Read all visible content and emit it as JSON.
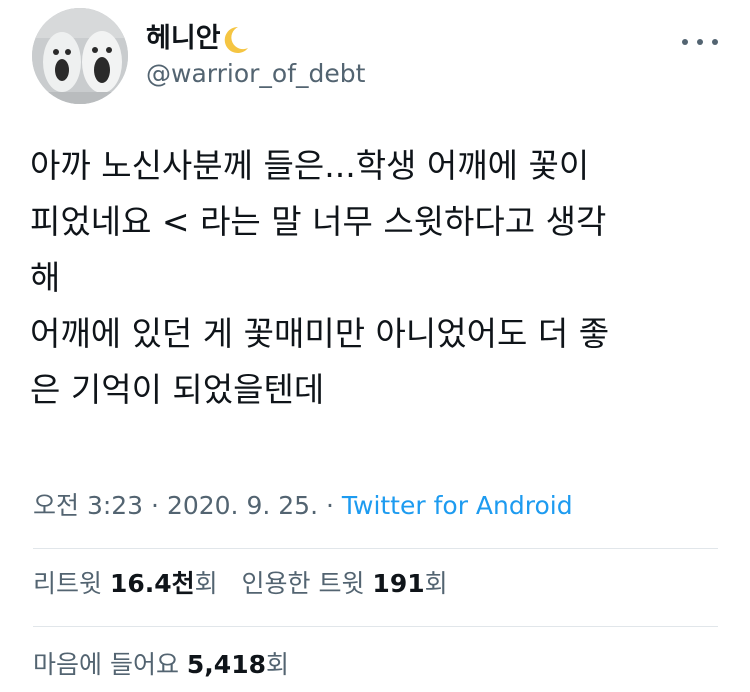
{
  "author": {
    "display_name": "헤니안",
    "handle": "@warrior_of_debt"
  },
  "tweet": {
    "lines": [
      "아까 노신사분께 들은...학생 어깨에 꽃이",
      "피었네요 < 라는 말 너무 스윗하다고 생각",
      "해",
      "어깨에 있던 게 꽃매미만 아니었어도 더 좋",
      "은 기억이 되었을텐데"
    ]
  },
  "meta": {
    "time": "오전 3:23",
    "separator": " · ",
    "date": "2020. 9. 25.",
    "separator2": " · ",
    "source": "Twitter for Android"
  },
  "stats": {
    "retweets_label": "리트윗",
    "retweets_value": "16.4천",
    "retweets_unit": "회",
    "quotes_label": "인용한 트윗",
    "quotes_value": "191",
    "quotes_unit": "회",
    "likes_label": "마음에 들어요",
    "likes_value": "5,418",
    "likes_unit": "회"
  },
  "icons": {
    "avatar": "snowman-faces-avatar",
    "emoji": "crescent-moon-icon",
    "menu": "more-icon"
  },
  "colors": {
    "text": "#0f1419",
    "secondary": "#536471",
    "link": "#1d9bf0",
    "divider": "#e1e6ea",
    "moon": "#f5c542"
  }
}
